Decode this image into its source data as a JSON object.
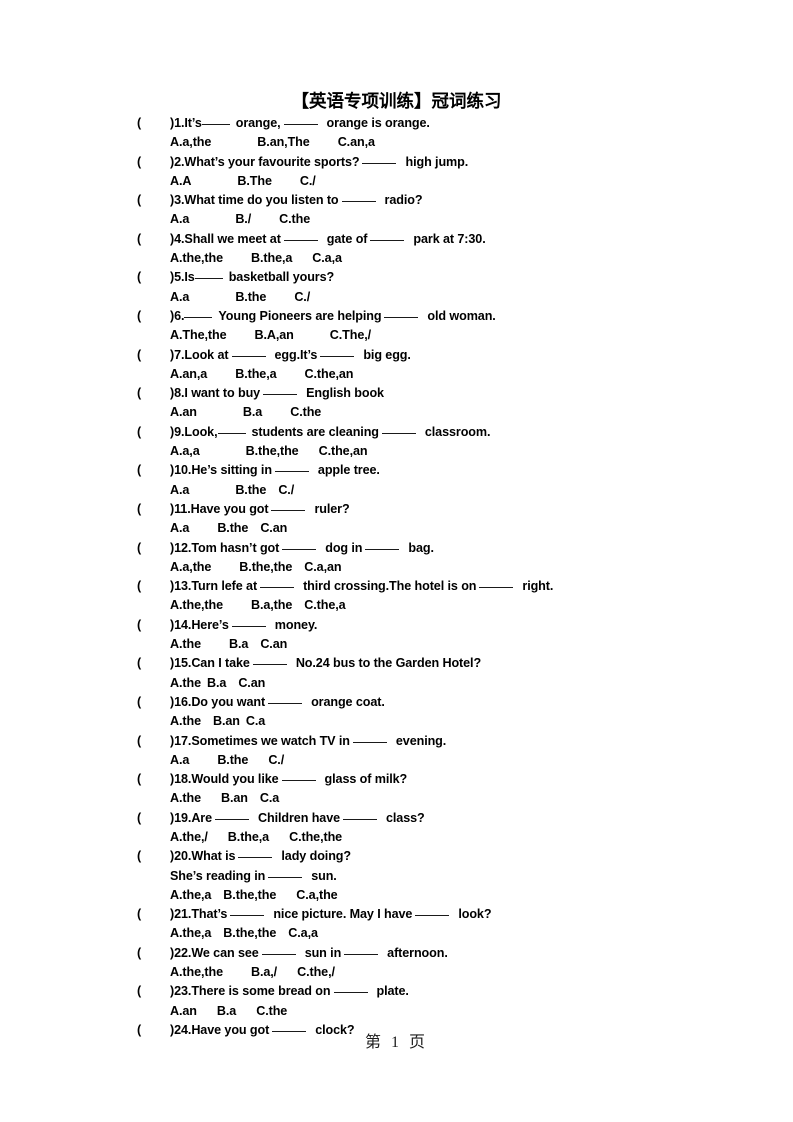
{
  "document": {
    "title": "【英语专项训练】冠词练习",
    "footer_page_label": "第 1 页",
    "text_color": "#000000",
    "background_color": "#ffffff"
  },
  "questions": [
    {
      "number": "1.",
      "question_pre": "It’s",
      "question_mid": "orange,",
      "question_post": "orange is orange.",
      "options": [
        "A.a,the",
        "B.an,The",
        "C.an,a"
      ]
    },
    {
      "number": "2.",
      "question_pre": "What’s your favourite sports?",
      "question_mid": "",
      "question_post": "high jump.",
      "options": [
        "A.A",
        "B.The",
        "C./"
      ]
    },
    {
      "number": "3.",
      "question_pre": "What time do you listen to",
      "question_mid": "",
      "question_post": "radio?",
      "options": [
        "A.a",
        "B./",
        "C.the"
      ]
    },
    {
      "number": "4.",
      "question_pre": "Shall we meet at",
      "question_mid": "gate of",
      "question_post": "park at 7:30.",
      "options": [
        "A.the,the",
        "B.the,a",
        "C.a,a"
      ]
    },
    {
      "number": "5.",
      "question_pre": "Is",
      "question_mid": "",
      "question_post": "basketball yours?",
      "options": [
        "A.a",
        "B.the",
        "C./"
      ]
    },
    {
      "number": "6.",
      "question_pre": "",
      "question_mid": "Young Pioneers are helping",
      "question_post": "old woman.",
      "options": [
        "A.The,the",
        "B.A,an",
        "C.The,/"
      ]
    },
    {
      "number": "7.",
      "question_pre": "Look at",
      "question_mid": "egg.It’s",
      "question_post": "big egg.",
      "options": [
        "A.an,a",
        "B.the,a",
        "C.the,an"
      ]
    },
    {
      "number": "8.",
      "question_pre": "I want to buy",
      "question_mid": "",
      "question_post": "English book",
      "options": [
        "A.an",
        "B.a",
        "C.the"
      ]
    },
    {
      "number": "9.",
      "question_pre": "Look,",
      "question_mid": "students are cleaning",
      "question_post": "classroom.",
      "options": [
        "A.a,a",
        "B.the,the",
        "C.the,an"
      ]
    },
    {
      "number": "10.",
      "question_pre": "He’s sitting in",
      "question_mid": "",
      "question_post": "apple tree.",
      "options": [
        "A.a",
        "B.the",
        "C./"
      ]
    },
    {
      "number": "11.",
      "question_pre": "Have you got",
      "question_mid": "",
      "question_post": "ruler?",
      "options": [
        "A.a",
        "B.the",
        "C.an"
      ]
    },
    {
      "number": "12.",
      "question_pre": "Tom hasn’t got",
      "question_mid": "dog in",
      "question_post": "bag.",
      "options": [
        "A.a,the",
        "B.the,the",
        "C.a,an"
      ]
    },
    {
      "number": "13.",
      "question_pre": "Turn lefe at",
      "question_mid": "third crossing.The hotel is on",
      "question_post": "right.",
      "options": [
        "A.the,the",
        "B.a,the",
        "C.the,a"
      ]
    },
    {
      "number": "14.",
      "question_pre": "Here’s",
      "question_mid": "",
      "question_post": "money.",
      "options": [
        "A.the",
        "B.a",
        "C.an"
      ]
    },
    {
      "number": "15.",
      "question_pre": "Can I take",
      "question_mid": "",
      "question_post": "No.24 bus to the Garden Hotel?",
      "options": [
        "A.the",
        "B.a",
        "C.an"
      ]
    },
    {
      "number": "16.",
      "question_pre": "Do you want",
      "question_mid": "",
      "question_post": "orange coat.",
      "options": [
        "A.the",
        "B.an",
        "C.a"
      ]
    },
    {
      "number": "17.",
      "question_pre": "Sometimes we watch TV in",
      "question_mid": "",
      "question_post": "evening.",
      "options": [
        "A.a",
        "B.the",
        "C./"
      ]
    },
    {
      "number": "18.",
      "question_pre": "Would you like",
      "question_mid": "",
      "question_post": "glass of milk?",
      "options": [
        "A.the",
        "B.an",
        "C.a"
      ]
    },
    {
      "number": "19.",
      "question_pre": "Are",
      "question_mid": "Children have",
      "question_post": "class?",
      "options": [
        "A.the,/",
        "B.the,a",
        "C.the,the"
      ]
    },
    {
      "number": "20.",
      "question_pre": "What is",
      "question_mid": "",
      "question_post": "lady doing?",
      "continuation_pre": "She’s reading in",
      "continuation_post": "sun.",
      "options": [
        "A.the,a",
        "B.the,the",
        "C.a,the"
      ]
    },
    {
      "number": "21.",
      "question_pre": "That’s",
      "question_mid": "nice picture. May I have",
      "question_post": "look?",
      "options": [
        "A.the,a",
        "B.the,the",
        "C.a,a"
      ]
    },
    {
      "number": "22.",
      "question_pre": "We can see",
      "question_mid": "sun in",
      "question_post": "afternoon.",
      "options": [
        "A.the,the",
        "B.a,/",
        "C.the,/"
      ]
    },
    {
      "number": "23.",
      "question_pre": "There is some bread on",
      "question_mid": "",
      "question_post": "plate.",
      "options": [
        "A.an",
        "B.a",
        "C.the"
      ]
    },
    {
      "number": "24.",
      "question_pre": "Have you got",
      "question_mid": "",
      "question_post": "clock?",
      "options": []
    }
  ]
}
